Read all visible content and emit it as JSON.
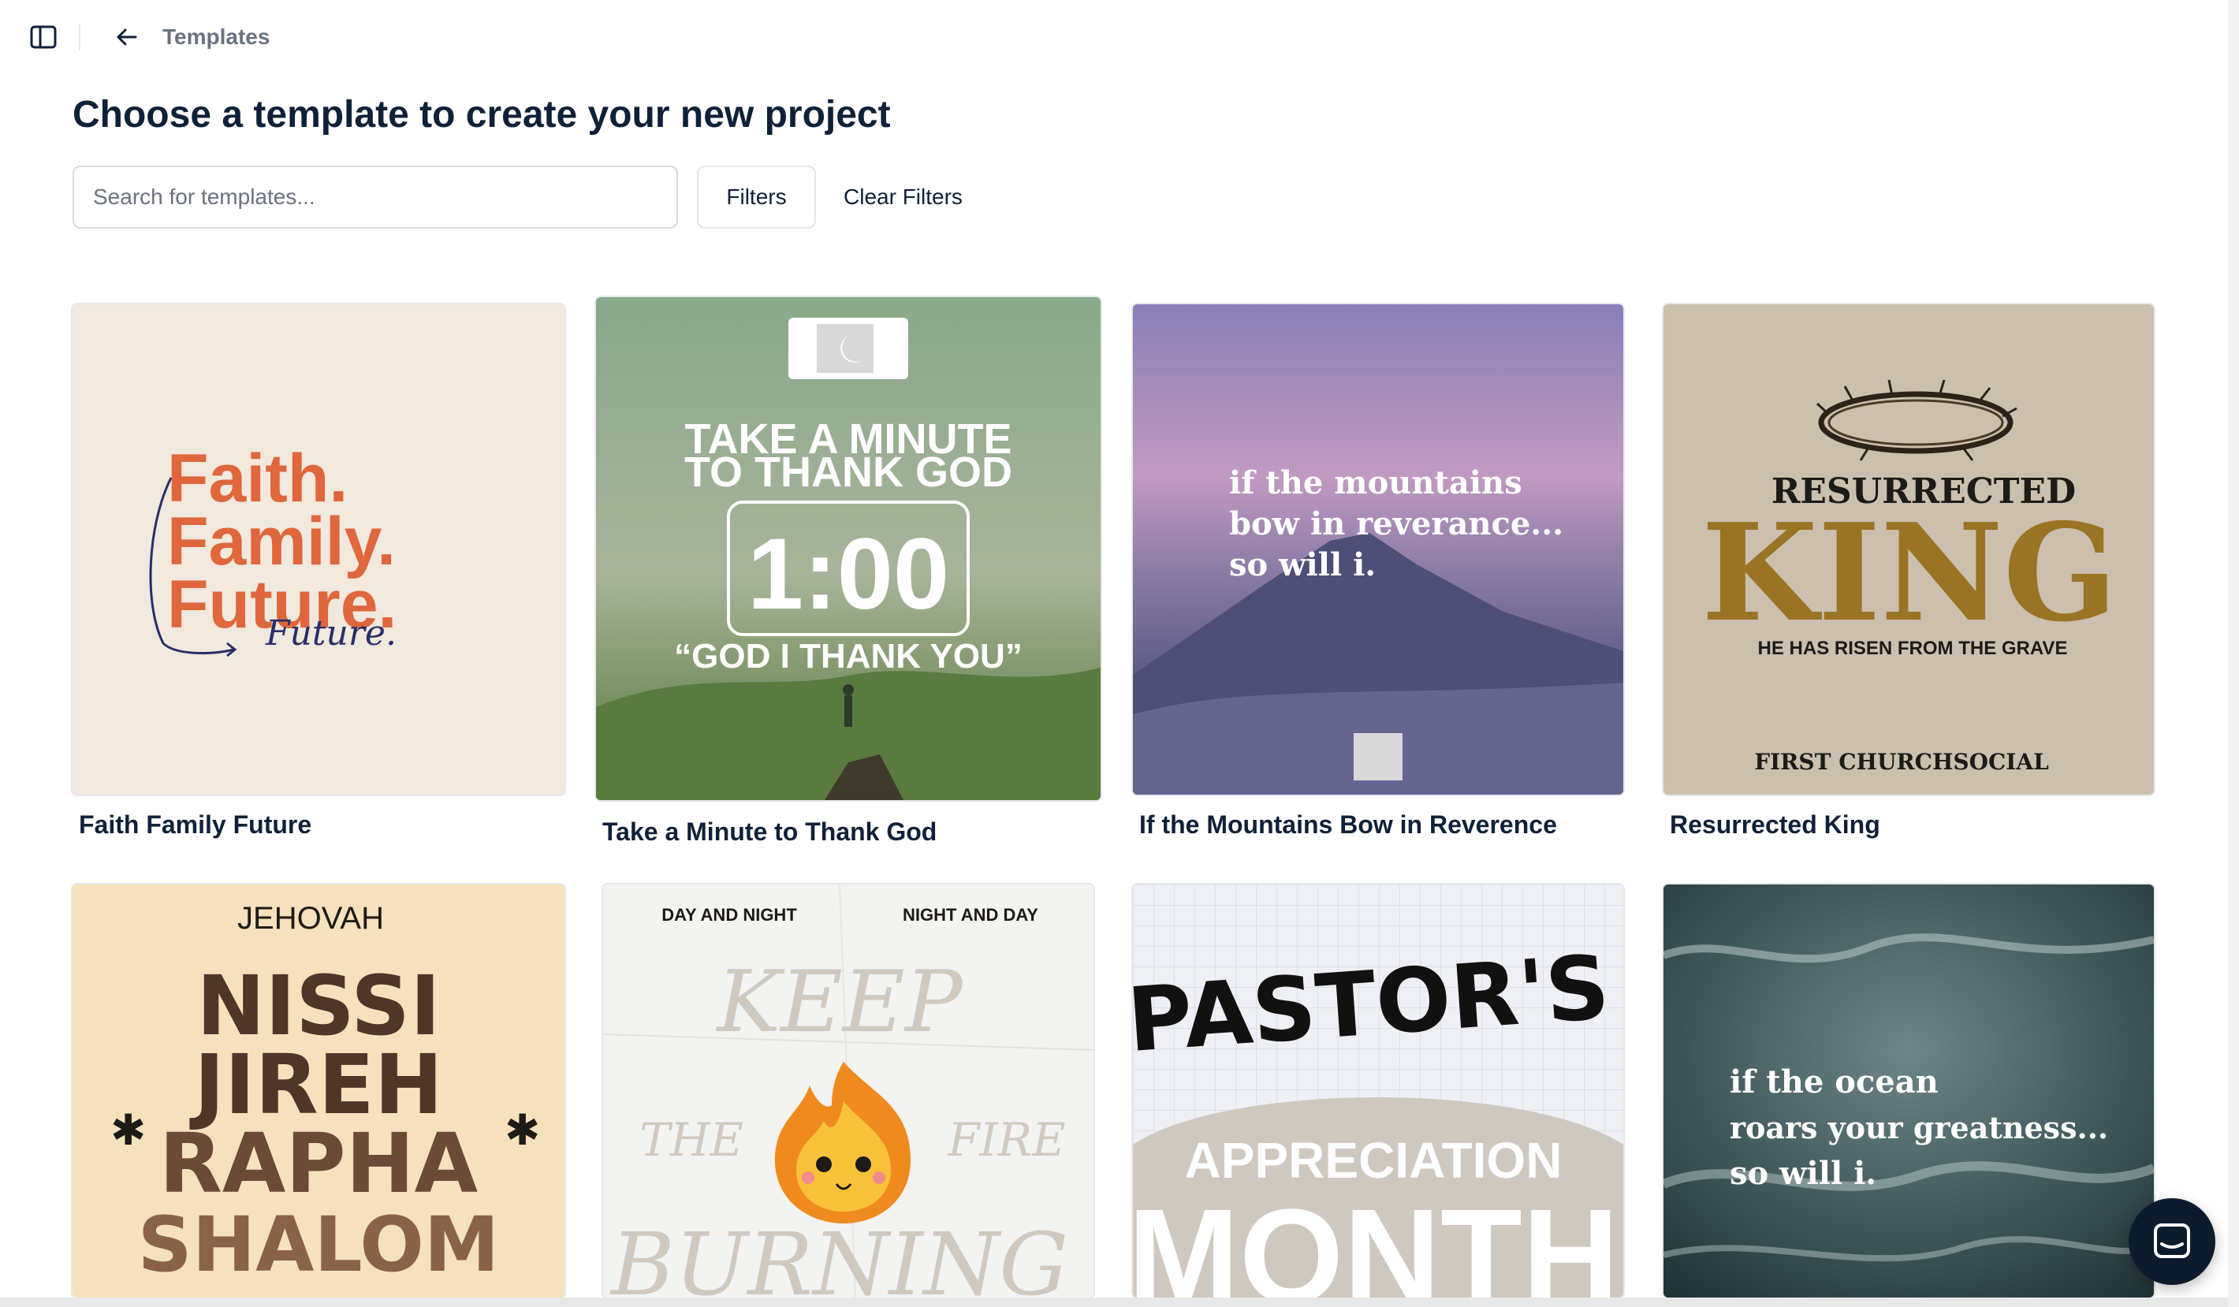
{
  "header": {
    "breadcrumb": "Templates"
  },
  "main": {
    "title": "Choose a template to create your new project",
    "search": {
      "placeholder": "Search for templates...",
      "value": ""
    },
    "filters_label": "Filters",
    "clear_filters_label": "Clear Filters"
  },
  "templates": [
    {
      "label": "Faith Family Future",
      "art": {
        "lines": [
          "Faith.",
          "Family.",
          "Future."
        ],
        "script": "Future."
      }
    },
    {
      "label": "Take a Minute to Thank God",
      "art": {
        "line1": "TAKE A MINUTE",
        "line2": "TO THANK GOD",
        "timer": "1:00",
        "quote": "“GOD I THANK YOU”"
      }
    },
    {
      "label": "If the Mountains Bow in Reverence",
      "art": {
        "lines": [
          "if the mountains",
          "bow in reverance...",
          "so will i."
        ]
      }
    },
    {
      "label": "Resurrected King",
      "art": {
        "top": "RESURRECTED",
        "big": "KING",
        "sub": "HE HAS RISEN FROM THE GRAVE",
        "footer": "FIRST CHURCHSOCIAL"
      }
    },
    {
      "label": "",
      "art": {
        "top": "JEHOVAH",
        "lines": [
          "NISSI",
          "JIREH",
          "RAPHA",
          "SHALOM"
        ]
      }
    },
    {
      "label": "",
      "art": {
        "left": "DAY AND NIGHT",
        "right": "NIGHT AND DAY",
        "keep": "KEEP",
        "the": "THE",
        "fire": "FIRE",
        "burning": "BURNING"
      }
    },
    {
      "label": "",
      "art": {
        "big": "PASTOR'S",
        "mid": "APPRECIATION",
        "bottom": "MONTH"
      }
    },
    {
      "label": "",
      "art": {
        "lines": [
          "if the ocean",
          "roars your greatness...",
          "so will i."
        ]
      }
    }
  ],
  "colors": {
    "text_primary": "#0f2138",
    "text_muted": "#6b7280",
    "border": "#d7dbe0",
    "faith_orange": "#e0663b",
    "king_gold": "#9a7424",
    "nissi_brown": "#4e3629"
  },
  "icons": [
    "sidebar-toggle-icon",
    "arrow-left-icon",
    "moon-icon",
    "crown-of-thorns-icon",
    "flame-icon",
    "chat-icon"
  ]
}
